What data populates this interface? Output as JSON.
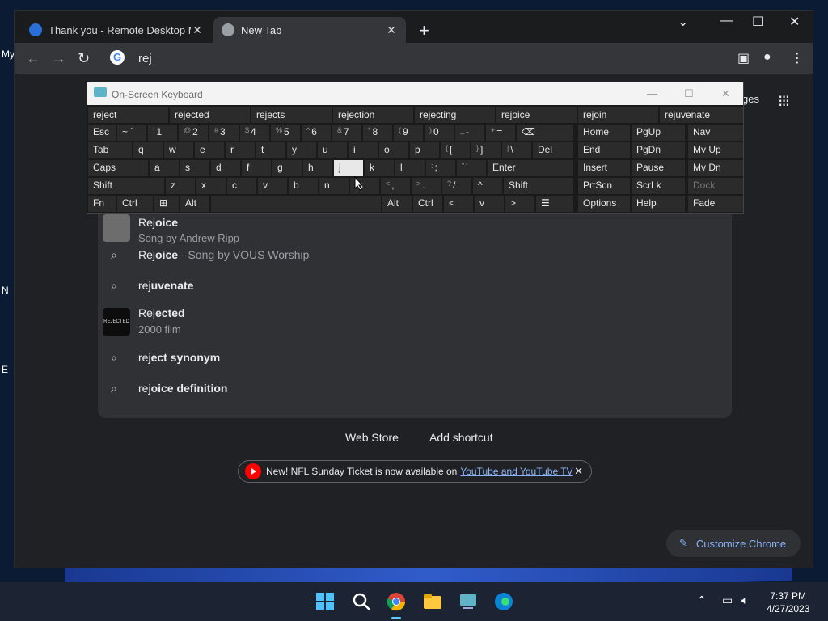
{
  "chrome": {
    "tabs": [
      {
        "title": "Thank you - Remote Desktop Ma",
        "active": false
      },
      {
        "title": "New Tab",
        "active": true
      }
    ],
    "omnibox_text": "rej"
  },
  "ntp": {
    "images_label": "ges",
    "web_store": "Web Store",
    "add_shortcut": "Add shortcut",
    "promo_text": "New! NFL Sunday Ticket is now available on",
    "promo_link": "YouTube and YouTube TV",
    "customize": "Customize Chrome"
  },
  "suggestions": [
    {
      "bold_prefix": "Rej",
      "rest": "oice",
      "secondary": "Song by Andrew Ripp",
      "kind": "thumbnail"
    },
    {
      "bold_prefix": "Rej",
      "rest": "oice",
      "suffix": " - Song by VOUS Worship",
      "kind": "search"
    },
    {
      "bold_prefix": "rej",
      "rest": "uvenate",
      "kind": "search"
    },
    {
      "bold_prefix": "Rej",
      "rest": "ected",
      "secondary": "2000 film",
      "kind": "thumbnail",
      "thumb_text": "REJECTED"
    },
    {
      "bold_prefix": "rej",
      "rest": "ect synonym",
      "kind": "search"
    },
    {
      "bold_prefix": "rej",
      "rest": "oice definition",
      "kind": "search"
    }
  ],
  "osk": {
    "title": "On-Screen Keyboard",
    "predictions": [
      "reject",
      "rejected",
      "rejects",
      "rejection",
      "rejecting",
      "rejoice",
      "rejoin",
      "rejuvenate"
    ],
    "row1": {
      "esc": "Esc",
      "tilde": "~ `",
      "k1": "1",
      "k1s": "!",
      "k2": "2",
      "k2s": "@",
      "k3": "3",
      "k3s": "#",
      "k4": "4",
      "k4s": "$",
      "k5": "5",
      "k5s": "%",
      "k6": "6",
      "k6s": "^",
      "k7": "7",
      "k7s": "&",
      "k8": "8",
      "k8s": "*",
      "k9": "9",
      "k9s": "(",
      "k0": "0",
      "k0s": ")",
      "minus": "-",
      "minuss": "_",
      "eq": "=",
      "eqs": "+",
      "bksp": "⌫",
      "home": "Home",
      "pgup": "PgUp",
      "nav": "Nav"
    },
    "row2": {
      "tab": "Tab",
      "q": "q",
      "w": "w",
      "e": "e",
      "r": "r",
      "t": "t",
      "y": "y",
      "u": "u",
      "i": "i",
      "o": "o",
      "p": "p",
      "lb": "[",
      "lbs": "{",
      "rb": "]",
      "rbs": "}",
      "bs": "\\",
      "bss": "|",
      "del": "Del",
      "end": "End",
      "pgdn": "PgDn",
      "mvup": "Mv Up"
    },
    "row3": {
      "caps": "Caps",
      "a": "a",
      "s": "s",
      "d": "d",
      "f": "f",
      "g": "g",
      "h": "h",
      "j": "j",
      "k": "k",
      "l": "l",
      "semi": ";",
      "semis": ":",
      "quot": "'",
      "quots": "\"",
      "enter": "Enter",
      "insert": "Insert",
      "pause": "Pause",
      "mvdn": "Mv Dn"
    },
    "row4": {
      "shift": "Shift",
      "z": "z",
      "x": "x",
      "c": "c",
      "v": "v",
      "b": "b",
      "n": "n",
      "m": "m",
      "comma": ",",
      "commas": "<",
      "dot": ".",
      "dots": ">",
      "slash": "/",
      "slashs": "?",
      "up": "^",
      "shift2": "Shift",
      "prtscn": "PrtScn",
      "scrlk": "ScrLk",
      "dock": "Dock"
    },
    "row5": {
      "fn": "Fn",
      "ctrl": "Ctrl",
      "alt": "Alt",
      "alt2": "Alt",
      "ctrl2": "Ctrl",
      "left": "<",
      "down": "v",
      "right": ">",
      "options": "Options",
      "help": "Help",
      "fade": "Fade"
    }
  },
  "taskbar": {
    "time": "7:37 PM",
    "date": "4/27/2023"
  },
  "desktop_labels": [
    "My",
    "N",
    "E"
  ],
  "colors": {
    "accent": "#8ab4f8",
    "chrome_bg": "#202124",
    "dropdown_bg": "#303134"
  }
}
